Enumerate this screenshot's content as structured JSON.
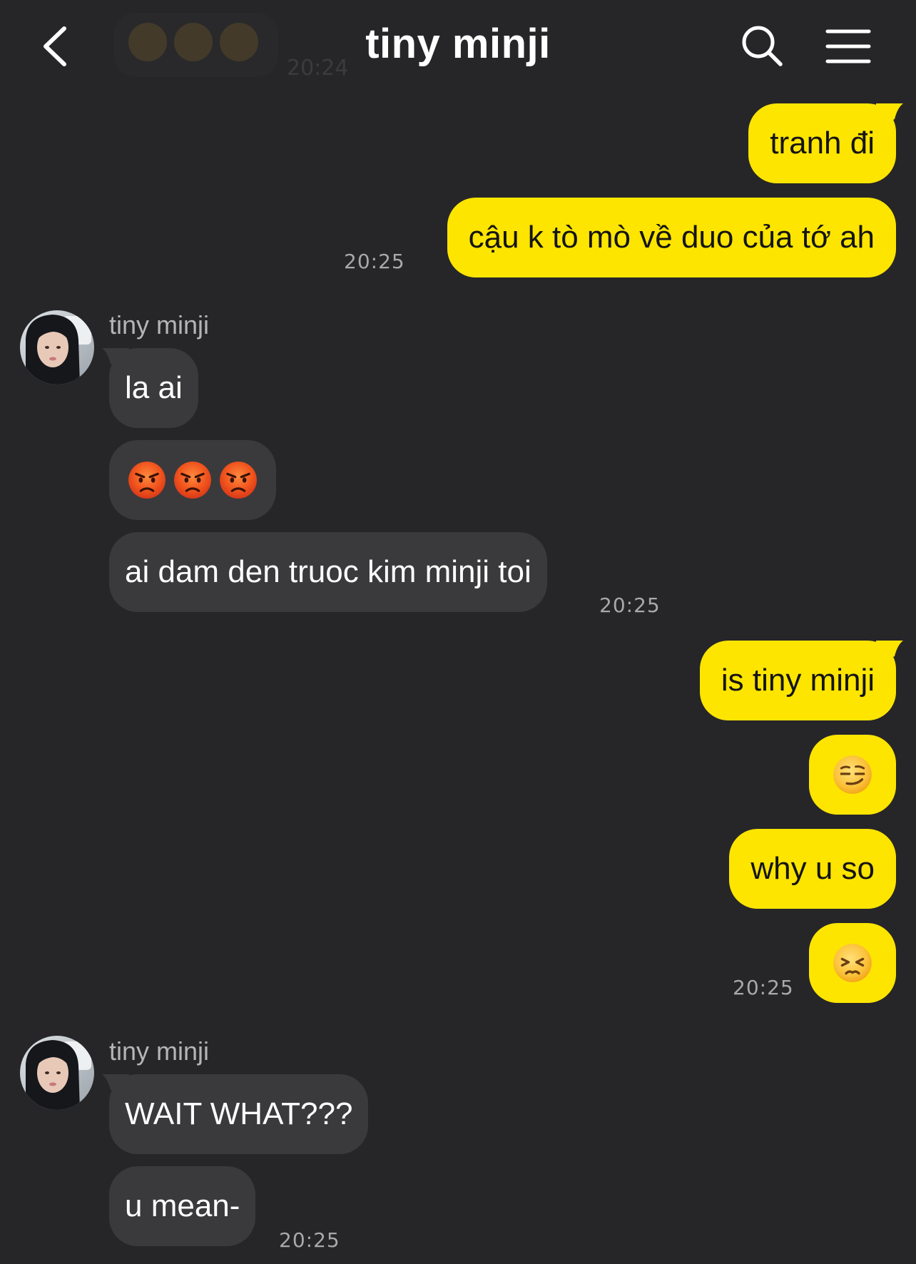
{
  "header": {
    "title": "tiny minji",
    "faded_time": "20:24"
  },
  "messages": {
    "m1": "tranh đi",
    "m2": "cậu k tò mò về duo của tớ ah",
    "t1": "20:25",
    "sender1": "tiny minji",
    "m3": "la ai",
    "m5": "ai dam den truoc kim minji toi",
    "t2": "20:25",
    "m6": "is tiny minji",
    "m8": "why u so",
    "t3": "20:25",
    "sender2": "tiny minji",
    "m10": "WAIT WHAT???",
    "m11": "u mean-",
    "t4": "20:25"
  },
  "emoji": {
    "m4": [
      "angry-face",
      "angry-face",
      "angry-face"
    ],
    "m7": "smirking-face",
    "m9": "persevering-face",
    "faded": [
      "pleading-face",
      "pleading-face",
      "pleading-face"
    ]
  },
  "colors": {
    "background": "#262628",
    "my_bubble": "#fde500",
    "their_bubble": "#3a3a3c",
    "timestamp": "#a9a9ab"
  }
}
